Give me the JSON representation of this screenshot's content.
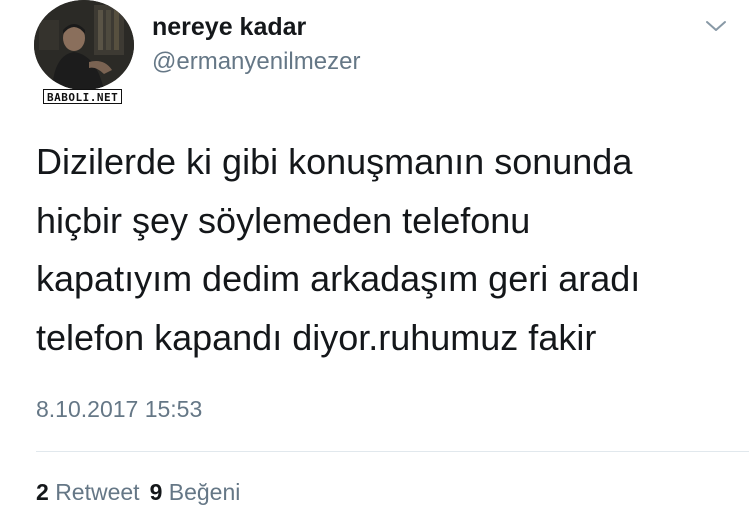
{
  "user": {
    "display_name": "nereye kadar",
    "handle": "@ermanyenilmezer"
  },
  "watermark": "BABOLI.NET",
  "icons": {
    "menu": "chevron-down-icon"
  },
  "tweet": {
    "lines": [
      "Dizilerde ki gibi konuşmanın sonunda",
      "hiçbir şey söylemeden telefonu",
      "kapatıyım dedim arkadaşım geri aradı",
      "telefon kapandı diyor.ruhumuz fakir"
    ],
    "timestamp": "8.10.2017 15:53"
  },
  "stats": {
    "retweets": {
      "count": "2",
      "label": "Retweet"
    },
    "likes": {
      "count": "9",
      "label": "Beğeni"
    }
  },
  "colors": {
    "primary_text": "#14171a",
    "secondary_text": "#657786",
    "divider": "#e1e8ed"
  }
}
